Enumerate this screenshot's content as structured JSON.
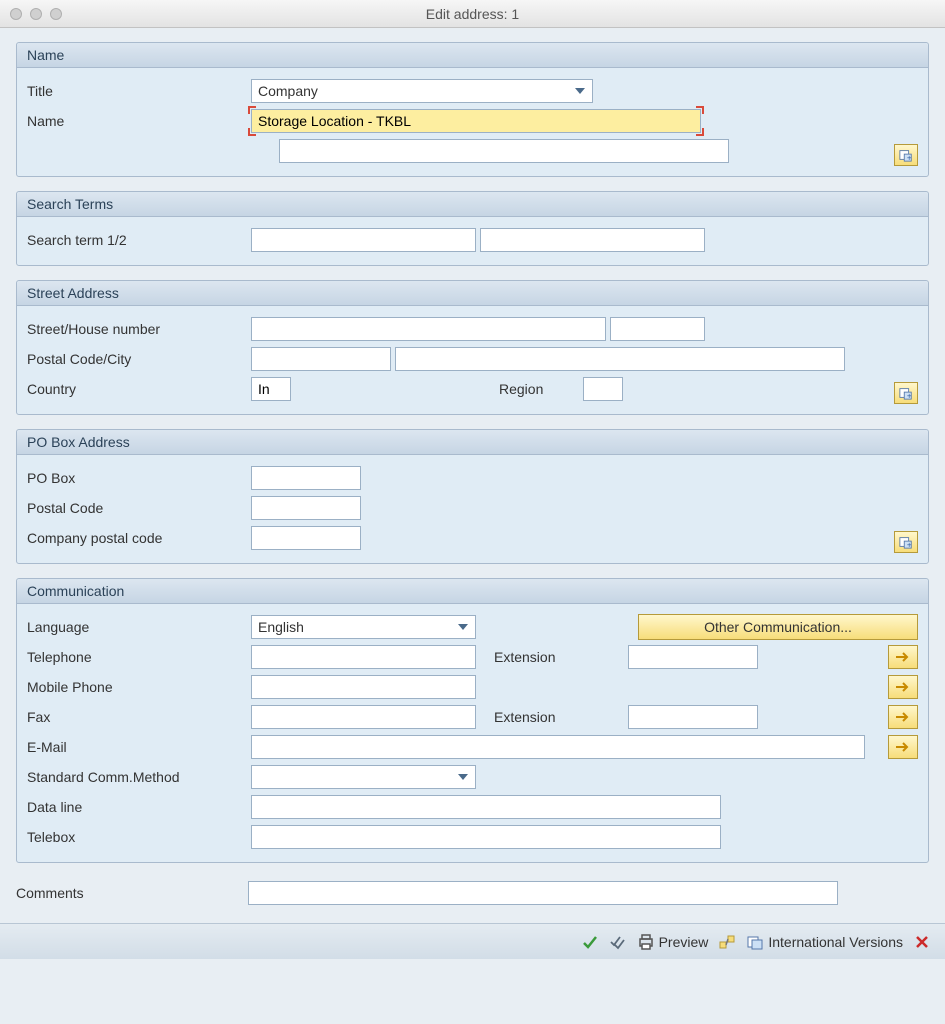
{
  "window": {
    "title": "Edit address:  1"
  },
  "name_section": {
    "header": "Name",
    "title_label": "Title",
    "title_value": "Company",
    "name_label": "Name",
    "name_value": "Storage Location - TKBL",
    "name_value2": ""
  },
  "search_section": {
    "header": "Search Terms",
    "search_label": "Search term 1/2",
    "term1": "",
    "term2": ""
  },
  "street_section": {
    "header": "Street Address",
    "street_label": "Street/House number",
    "street": "",
    "house_no": "",
    "postal_city_label": "Postal Code/City",
    "postal": "",
    "city": "",
    "country_label": "Country",
    "country": "In",
    "region_label": "Region",
    "region": ""
  },
  "pobox_section": {
    "header": "PO Box Address",
    "pobox_label": "PO Box",
    "pobox": "",
    "postal_label": "Postal Code",
    "postal": "",
    "companypostal_label": "Company postal code",
    "companypostal": ""
  },
  "comm_section": {
    "header": "Communication",
    "language_label": "Language",
    "language_value": "English",
    "other_comm_button": "Other Communication...",
    "telephone_label": "Telephone",
    "telephone": "",
    "telephone_ext_label": "Extension",
    "telephone_ext": "",
    "mobile_label": "Mobile Phone",
    "mobile": "",
    "fax_label": "Fax",
    "fax": "",
    "fax_ext_label": "Extension",
    "fax_ext": "",
    "email_label": "E-Mail",
    "email": "",
    "stdcomm_label": "Standard Comm.Method",
    "stdcomm_value": "",
    "dataline_label": "Data line",
    "dataline": "",
    "telebox_label": "Telebox",
    "telebox": ""
  },
  "comments": {
    "label": "Comments",
    "value": ""
  },
  "statusbar": {
    "preview": "Preview",
    "international": "International Versions"
  }
}
